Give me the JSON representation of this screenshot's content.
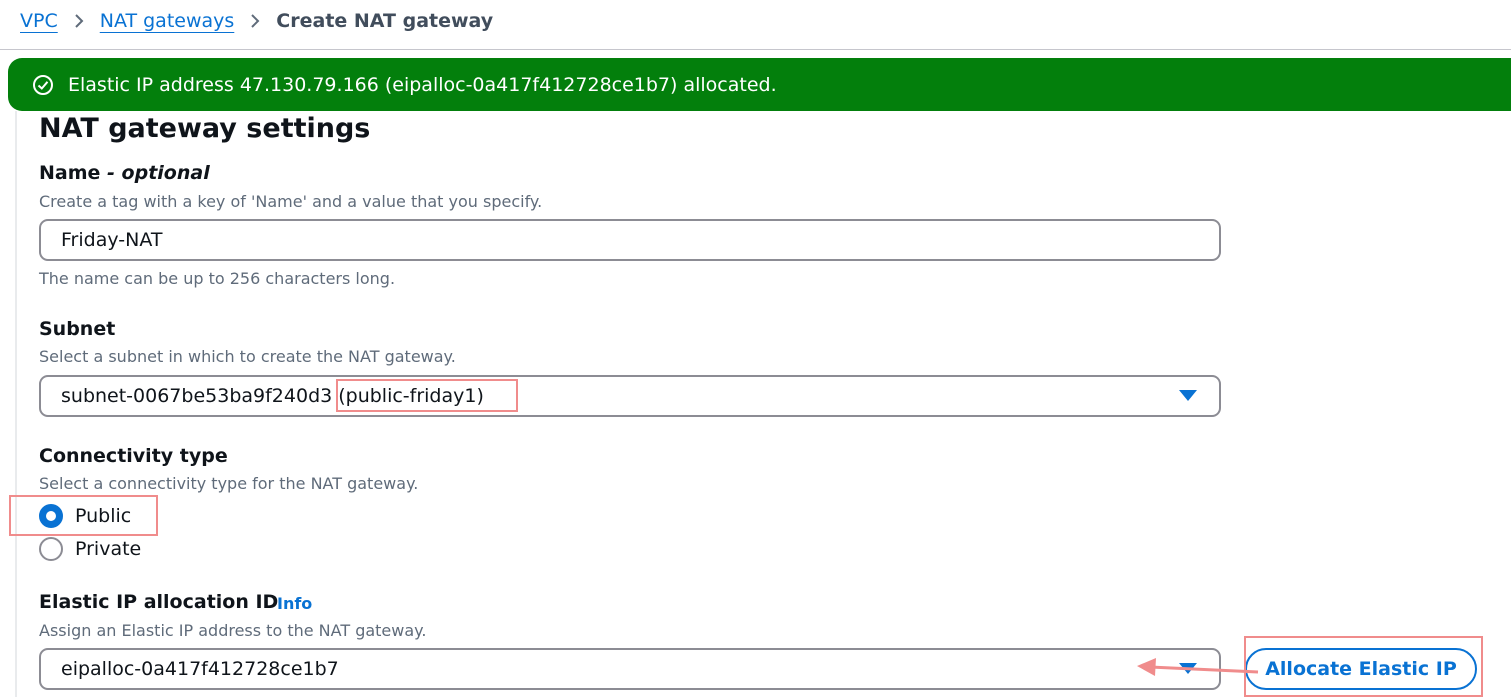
{
  "breadcrumb": {
    "items": [
      "VPC",
      "NAT gateways"
    ],
    "current": "Create NAT gateway"
  },
  "flash": {
    "message": "Elastic IP address 47.130.79.166 (eipalloc-0a417f412728ce1b7) allocated."
  },
  "section": {
    "title": "NAT gateway settings"
  },
  "name_field": {
    "label": "Name",
    "optional": "- optional",
    "description": "Create a tag with a key of 'Name' and a value that you specify.",
    "value": "Friday-NAT",
    "hint": "The name can be up to 256 characters long."
  },
  "subnet_field": {
    "label": "Subnet",
    "description": "Select a subnet in which to create the NAT gateway.",
    "value_id": "subnet-0067be53ba9f240d3",
    "value_name": "(public-friday1)"
  },
  "connectivity": {
    "label": "Connectivity type",
    "description": "Select a connectivity type for the NAT gateway.",
    "options": [
      "Public",
      "Private"
    ],
    "selected": "Public"
  },
  "eip_field": {
    "label": "Elastic IP allocation ID",
    "info": "Info",
    "description": "Assign an Elastic IP address to the NAT gateway.",
    "value": "eipalloc-0a417f412728ce1b7",
    "button": "Allocate Elastic IP"
  },
  "colors": {
    "accent": "#0972d3",
    "success": "#037f0c",
    "annotation": "#f08c8c"
  }
}
